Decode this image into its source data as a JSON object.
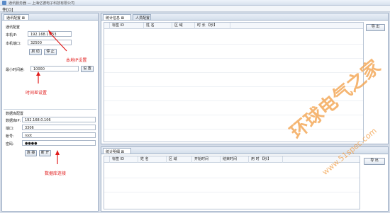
{
  "window": {
    "title": "通讯服务器 — 上海亿德电子科技有限公司"
  },
  "menu": {
    "label": "件[O]"
  },
  "left_panel": {
    "tab_label": "通讯配置",
    "comm": {
      "section_label": "通讯配置",
      "ip_label": "本机IP:",
      "ip_value": "192.168.1.253",
      "port_label": "本机端口:",
      "port_value": "32500",
      "start_label": "启 动",
      "stop_label": "停 止"
    },
    "interval": {
      "label": "最小时间差:",
      "value": "10000",
      "set_label": "设 置"
    },
    "db": {
      "section_label": "数据库配置",
      "ip_label": "数据库IP:",
      "ip_value": "192.168.0.106",
      "port_label": "端口:",
      "port_value": "3306",
      "account_label": "帐号:",
      "account_value": "root",
      "password_label": "密码:",
      "password_value": "●●●●",
      "connect_label": "连 接",
      "disconnect_label": "断 开"
    }
  },
  "annotations": {
    "local_ip": "本地IP设置",
    "interval": "时间差设置",
    "db": "数据库连接"
  },
  "top_panel": {
    "tabs": [
      {
        "label": "统计信息"
      },
      {
        "label": "人员配置"
      }
    ],
    "columns": [
      "标签 ID",
      "姓 名",
      "区 域",
      "时 长 【秒】"
    ],
    "export_label": "导 出"
  },
  "bottom_panel": {
    "tab_label": "统计明细",
    "columns": [
      "标签 ID",
      "姓 名",
      "区 域",
      "开始时间",
      "结束时间",
      "用 时 【秒】"
    ],
    "export_label": "导 出"
  },
  "watermark": {
    "text": "环球电气之家",
    "url": "www.51spec.com"
  },
  "colors": {
    "annotation": "#e11c1c",
    "watermark": "#f3a24d",
    "panel_border": "#9fb0c6"
  }
}
